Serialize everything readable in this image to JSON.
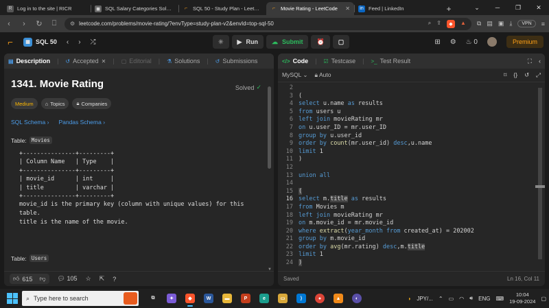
{
  "browser": {
    "tabs": [
      {
        "title": "Log in to the site | RICR",
        "fav": "R",
        "favcolor": "#555"
      },
      {
        "title": "SQL Salary Categories Solution",
        "fav": "◼",
        "favcolor": "#666"
      },
      {
        "title": "SQL 50 - Study Plan - LeetCode",
        "fav": "⌐",
        "favcolor": "#1f1f1f"
      },
      {
        "title": "Movie Rating - LeetCode",
        "fav": "⌐",
        "favcolor": "#1f1f1f",
        "active": true
      },
      {
        "title": "Feed | LinkedIn",
        "fav": "in",
        "favcolor": "#0a66c2"
      }
    ],
    "url": "leetcode.com/problems/movie-rating/?envType=study-plan-v2&envId=top-sql-50",
    "vpn_label": "VPN"
  },
  "header": {
    "study_plan": "SQL 50",
    "run_label": "Run",
    "submit_label": "Submit",
    "streak": "0",
    "premium_label": "Premium"
  },
  "left_tabs": {
    "description": "Description",
    "accepted": "Accepted",
    "editorial": "Editorial",
    "solutions": "Solutions",
    "submissions": "Submissions"
  },
  "problem": {
    "title": "1341. Movie Rating",
    "status": "Solved",
    "difficulty": "Medium",
    "topics": "Topics",
    "companies": "Companies",
    "sql_schema": "SQL Schema",
    "pandas_schema": "Pandas Schema",
    "table_label": "Table:",
    "table1": "Movies",
    "table2": "Users",
    "schema_text": "+---------------+---------+\n| Column Name   | Type    |\n+---------------+---------+\n| movie_id      | int     |\n| title         | varchar |\n+---------------+---------+",
    "para1": "movie_id is the primary key (column with unique values) for this table.",
    "para2": "title is the name of the movie.",
    "likes": "615",
    "comments": "105"
  },
  "right_tabs": {
    "code": "Code",
    "testcase": "Testcase",
    "test_result": "Test Result"
  },
  "editor": {
    "language": "MySQL",
    "mode": "Auto",
    "saved": "Saved",
    "cursor": "Ln 16, Col 11"
  },
  "taskbar": {
    "search_placeholder": "Type here to search",
    "currency": "JPY/...",
    "lang": "ENG",
    "time": "10:04",
    "date": "19-09-2024"
  }
}
